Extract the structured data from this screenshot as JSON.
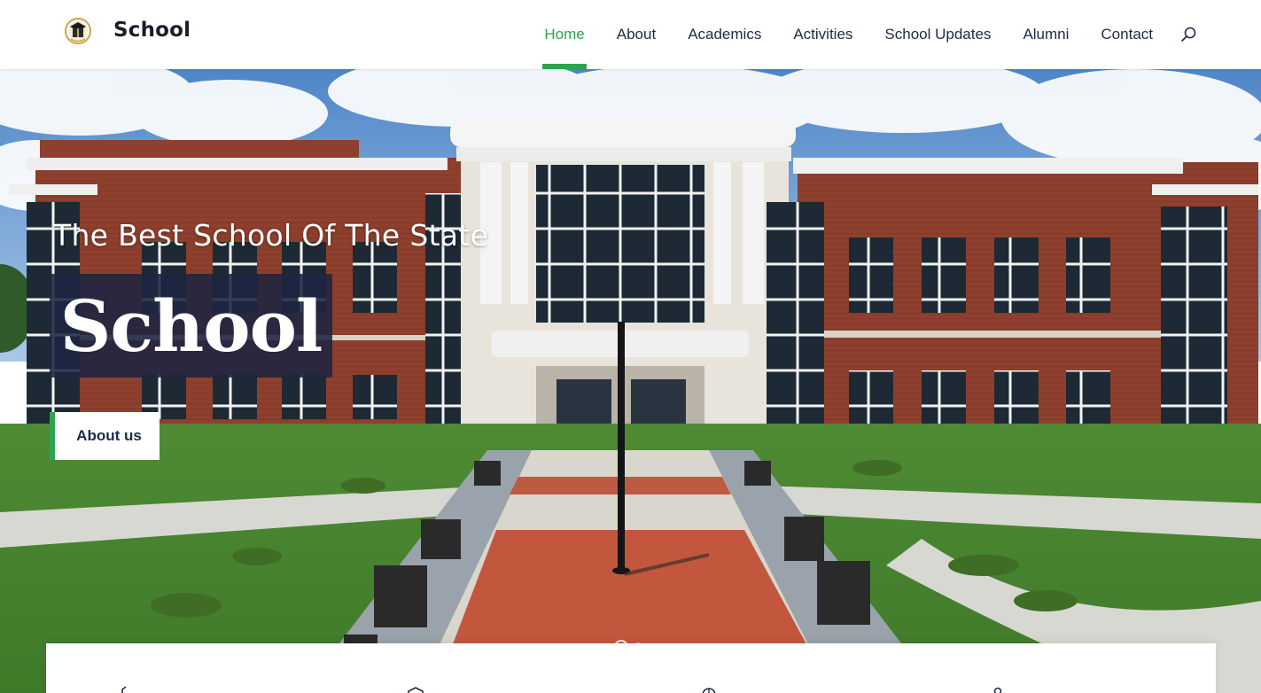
{
  "brand": {
    "name": "School"
  },
  "nav": {
    "items": [
      {
        "label": "Home",
        "active": true
      },
      {
        "label": "About",
        "active": false
      },
      {
        "label": "Academics",
        "active": false
      },
      {
        "label": "Activities",
        "active": false
      },
      {
        "label": "School Updates",
        "active": false
      },
      {
        "label": "Alumni",
        "active": false
      },
      {
        "label": "Contact",
        "active": false
      }
    ],
    "search_icon": "search-icon"
  },
  "hero": {
    "subtitle": "The Best School Of The State",
    "title": "School",
    "cta_label": "About us",
    "slides": 2,
    "active_slide": 1
  },
  "features": {
    "icons": [
      "book-icon",
      "shield-icon",
      "globe-icon",
      "person-icon"
    ]
  },
  "colors": {
    "accent": "#2ea44f",
    "nav_text": "#1e2a4a",
    "title_box": "#1e2442",
    "brick": "#8e3f2d"
  }
}
